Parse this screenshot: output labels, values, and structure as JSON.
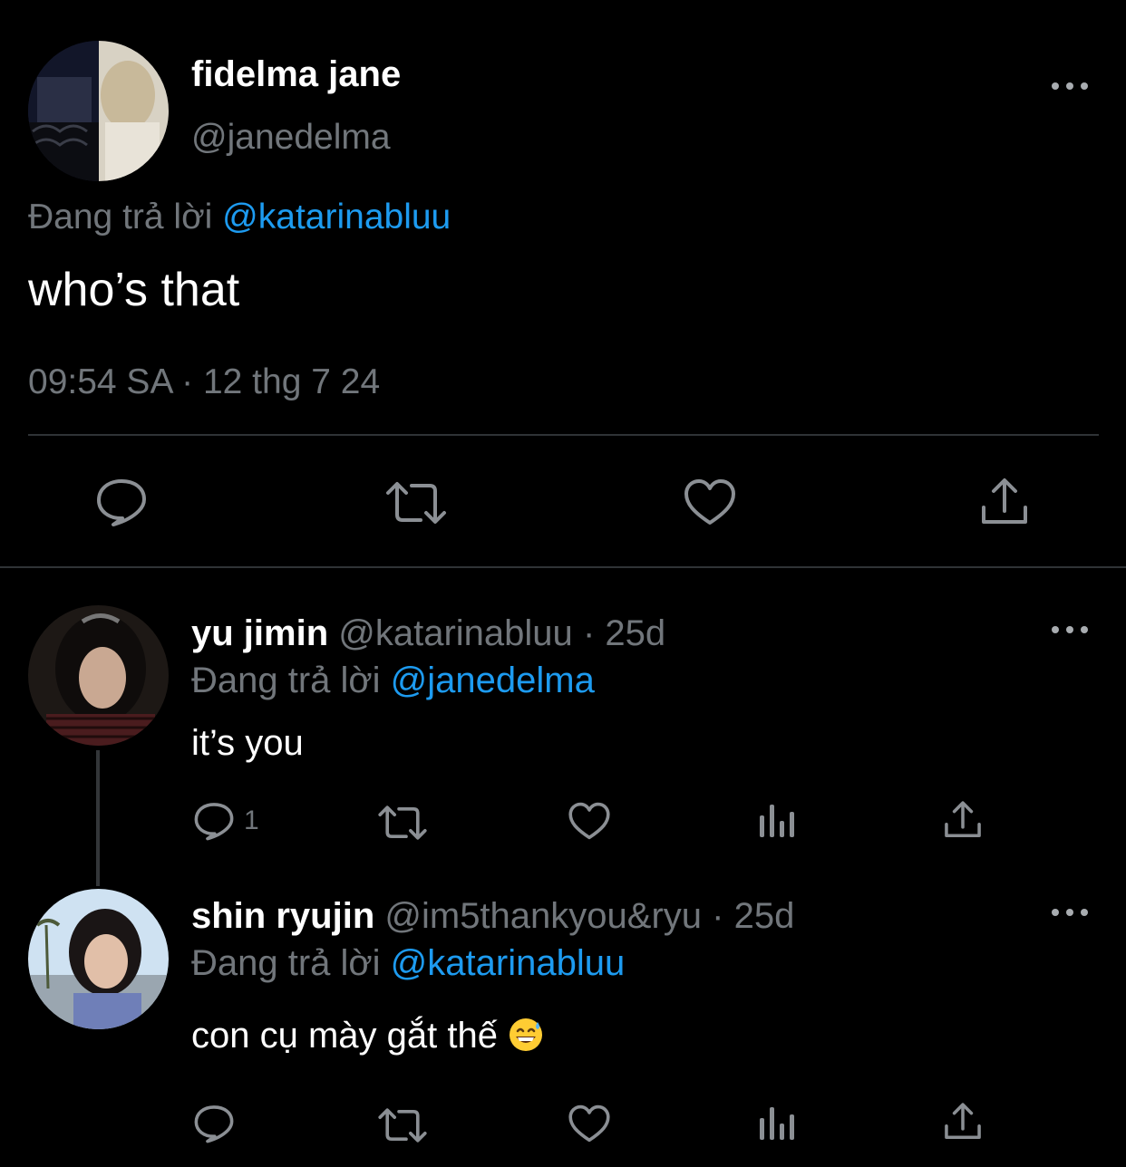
{
  "main_tweet": {
    "display_name": "fidelma jane",
    "handle": "@janedelma",
    "replying_prefix": "Đang trả lời",
    "replying_to": "@katarinabluu",
    "text": "who’s that",
    "timestamp": "09:54 SA · 12 thg 7 24",
    "actions": [
      "reply-icon",
      "retweet-icon",
      "like-icon",
      "share-icon"
    ]
  },
  "replies": [
    {
      "display_name": "yu jimin",
      "handle": "@katarinabluu",
      "age": "25d",
      "replying_prefix": "Đang trả lời",
      "replying_to": "@janedelma",
      "text": "it’s you",
      "reply_count": "1"
    },
    {
      "display_name": "shin ryujin",
      "handle": "@im5thankyou&ryu",
      "age": "25d",
      "replying_prefix": "Đang trả lời",
      "replying_to": "@katarinabluu",
      "text": "con cụ mày gắt thế",
      "emoji": "grinning-sweat-emoji",
      "reply_count": ""
    }
  ],
  "separator": "·",
  "colors": {
    "background": "#000000",
    "primary_text": "#ffffff",
    "secondary_text": "#71767b",
    "mention": "#1d9bf0",
    "divider": "#2f3336"
  }
}
